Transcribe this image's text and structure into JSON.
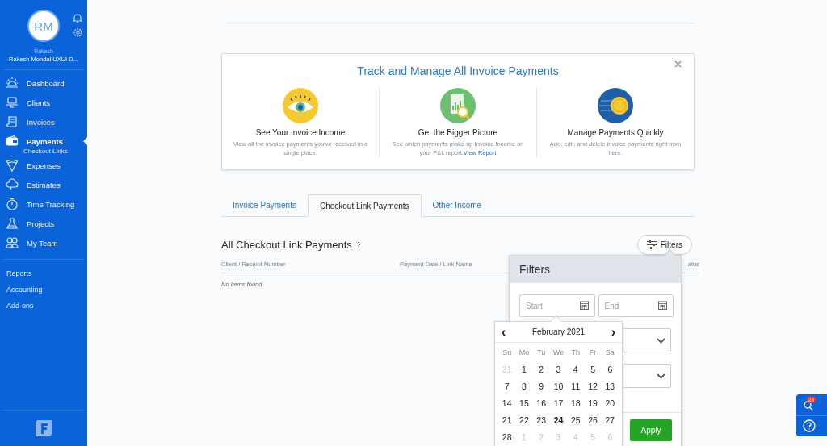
{
  "sidebar": {
    "avatar_initials": "RM",
    "user_first_name": "Rakesh",
    "account_name": "Rakesh Mondal UXUI D...",
    "nav_items": [
      {
        "label": "Dashboard",
        "selected": false
      },
      {
        "label": "Clients",
        "selected": false
      },
      {
        "label": "Invoices",
        "selected": false
      },
      {
        "label": "Payments",
        "selected": true,
        "children": [
          {
            "label": "Checkout Links",
            "selected": false
          }
        ]
      },
      {
        "label": "Expenses",
        "selected": false
      },
      {
        "label": "Estimates",
        "selected": false
      },
      {
        "label": "Time Tracking",
        "selected": false
      },
      {
        "label": "Projects",
        "selected": false
      },
      {
        "label": "My Team",
        "selected": false
      }
    ],
    "secondary_items": [
      {
        "label": "Reports"
      },
      {
        "label": "Accounting"
      },
      {
        "label": "Add-ons"
      }
    ]
  },
  "info_card": {
    "title": "Track and Manage All Invoice Payments",
    "features": [
      {
        "title": "See Your Invoice Income",
        "description": "View all the invoice payments you've received in a single place."
      },
      {
        "title": "Get the Bigger Picture",
        "description": "See which payments make up Invoice Income on your P&L report.",
        "link": "View Report"
      },
      {
        "title": "Manage Payments Quickly",
        "description": "Add, edit, and delete invoice payments right from here."
      }
    ]
  },
  "tabs": [
    {
      "label": "Invoice Payments",
      "selected": false
    },
    {
      "label": "Checkout Link Payments",
      "selected": true
    },
    {
      "label": "Other Income",
      "selected": false
    }
  ],
  "list": {
    "title": "All Checkout Link Payments",
    "filters_button": "Filters",
    "columns": [
      "Client / Receipt Number",
      "Payment Date / Link Name",
      "atus"
    ],
    "empty_message": "No items found"
  },
  "filters_panel": {
    "title": "Filters",
    "start": {
      "placeholder": "Start"
    },
    "end": {
      "placeholder": "End"
    },
    "apply_button": "Apply"
  },
  "date_picker": {
    "month": "February 2021",
    "prev": "‹",
    "next": "›",
    "weekdays": [
      "Su",
      "Mo",
      "Tu",
      "We",
      "Th",
      "Fr",
      "Sa"
    ],
    "weeks": [
      [
        {
          "day": "31",
          "muted": true,
          "today": false
        },
        {
          "day": "1",
          "muted": false,
          "today": false
        },
        {
          "day": "2",
          "muted": false,
          "today": false
        },
        {
          "day": "3",
          "muted": false,
          "today": false
        },
        {
          "day": "4",
          "muted": false,
          "today": false
        },
        {
          "day": "5",
          "muted": false,
          "today": false
        },
        {
          "day": "6",
          "muted": false,
          "today": false
        }
      ],
      [
        {
          "day": "7",
          "muted": false,
          "today": false
        },
        {
          "day": "8",
          "muted": false,
          "today": false
        },
        {
          "day": "9",
          "muted": false,
          "today": false
        },
        {
          "day": "10",
          "muted": false,
          "today": false
        },
        {
          "day": "11",
          "muted": false,
          "today": false
        },
        {
          "day": "12",
          "muted": false,
          "today": false
        },
        {
          "day": "13",
          "muted": false,
          "today": false
        }
      ],
      [
        {
          "day": "14",
          "muted": false,
          "today": false
        },
        {
          "day": "15",
          "muted": false,
          "today": false
        },
        {
          "day": "16",
          "muted": false,
          "today": false
        },
        {
          "day": "17",
          "muted": false,
          "today": false
        },
        {
          "day": "18",
          "muted": false,
          "today": false
        },
        {
          "day": "19",
          "muted": false,
          "today": false
        },
        {
          "day": "20",
          "muted": false,
          "today": false
        }
      ],
      [
        {
          "day": "21",
          "muted": false,
          "today": false
        },
        {
          "day": "22",
          "muted": false,
          "today": false
        },
        {
          "day": "23",
          "muted": false,
          "today": false
        },
        {
          "day": "24",
          "muted": false,
          "today": true
        },
        {
          "day": "25",
          "muted": false,
          "today": false
        },
        {
          "day": "26",
          "muted": false,
          "today": false
        },
        {
          "day": "27",
          "muted": false,
          "today": false
        }
      ],
      [
        {
          "day": "28",
          "muted": false,
          "today": false
        },
        {
          "day": "1",
          "muted": true,
          "today": false
        },
        {
          "day": "2",
          "muted": true,
          "today": false
        },
        {
          "day": "3",
          "muted": true,
          "today": false
        },
        {
          "day": "4",
          "muted": true,
          "today": false
        },
        {
          "day": "5",
          "muted": true,
          "today": false
        },
        {
          "day": "6",
          "muted": true,
          "today": false
        }
      ]
    ]
  },
  "help_widget": {
    "notification_count": "28"
  }
}
